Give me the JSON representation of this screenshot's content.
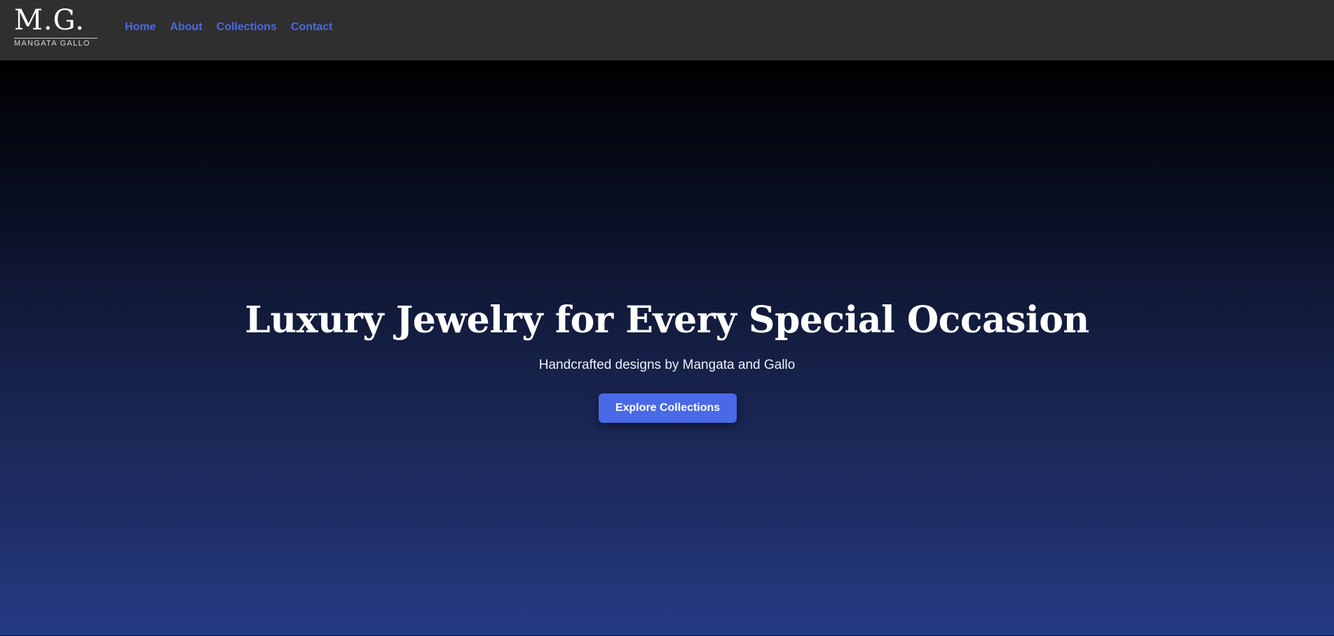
{
  "brand": {
    "logo_mark": "M.G.",
    "logo_sub": "MANGATA GALLO"
  },
  "nav": {
    "items": [
      {
        "label": "Home"
      },
      {
        "label": "About"
      },
      {
        "label": "Collections"
      },
      {
        "label": "Contact"
      }
    ]
  },
  "hero": {
    "title": "Luxury Jewelry for Every Special Occasion",
    "subtitle": "Handcrafted designs by Mangata and Gallo",
    "cta_label": "Explore Collections"
  },
  "colors": {
    "navbar_bg": "#2f2f2f",
    "accent": "#4a69e6",
    "hero_gradient_top": "#000000",
    "hero_gradient_bottom": "#253b85",
    "text": "#ffffff"
  }
}
